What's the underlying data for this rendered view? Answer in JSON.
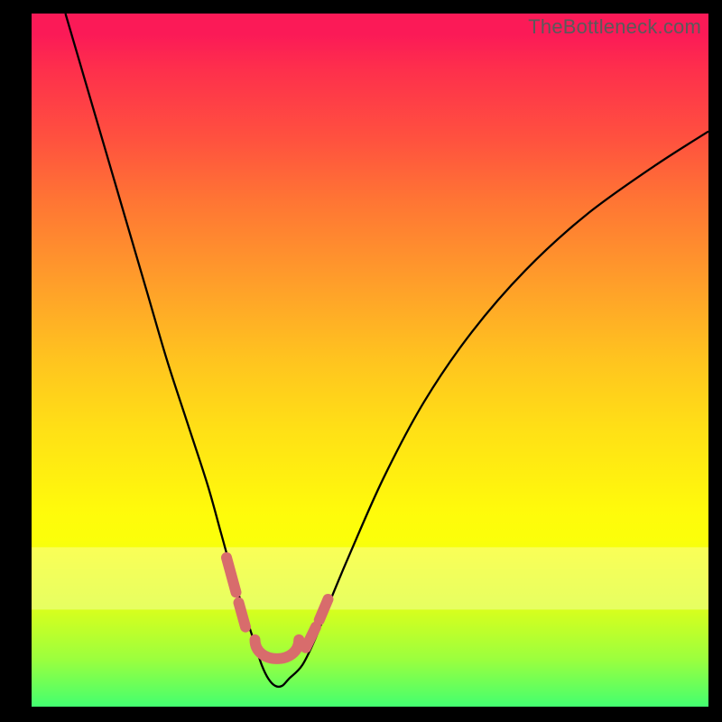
{
  "watermark": "TheBottleneck.com",
  "colors": {
    "frame": "#000000",
    "curve_main": "#000000",
    "curve_accent": "#d86c6c",
    "grad_top": "#fb1a57",
    "grad_bottom": "#43ff70"
  },
  "chart_data": {
    "type": "line",
    "title": "",
    "xlabel": "",
    "ylabel": "",
    "xlim": [
      0,
      100
    ],
    "ylim": [
      0,
      100
    ],
    "series": [
      {
        "name": "bottleneck-curve",
        "x": [
          5,
          8,
          11,
          14,
          17,
          20,
          23,
          26,
          28,
          30,
          32,
          33,
          34,
          35,
          36,
          37,
          38,
          40,
          42,
          44,
          47,
          52,
          58,
          65,
          73,
          82,
          92,
          100
        ],
        "y": [
          100,
          90,
          80,
          70,
          60,
          50,
          41,
          32,
          25,
          18,
          12,
          9,
          6,
          4,
          3,
          3,
          4,
          6,
          10,
          15,
          22,
          33,
          44,
          54,
          63,
          71,
          78,
          83
        ]
      }
    ],
    "accent_segments": [
      {
        "x": [
          28.8,
          30.2
        ],
        "y": [
          21.5,
          16.5
        ]
      },
      {
        "x": [
          30.6,
          31.6
        ],
        "y": [
          15.0,
          11.5
        ]
      },
      {
        "x": [
          33.0,
          39.5
        ],
        "y": [
          6.0,
          6.0
        ],
        "rounded_bottom": true
      },
      {
        "x": [
          40.5,
          42.0
        ],
        "y": [
          8.5,
          11.5
        ]
      },
      {
        "x": [
          42.5,
          43.8
        ],
        "y": [
          12.5,
          15.5
        ]
      }
    ],
    "pale_band": {
      "y0": 77,
      "y1": 86
    }
  }
}
